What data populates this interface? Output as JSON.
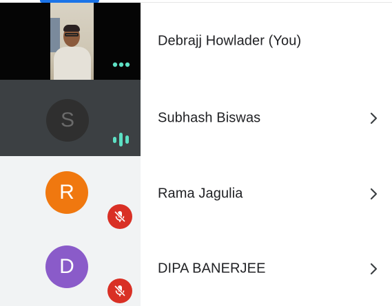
{
  "participants": [
    {
      "name": "Debrajj Howlader (You)",
      "tile": "video",
      "indicator": "more-dots"
    },
    {
      "name": "Subhash Biswas",
      "initial": "S",
      "tile": "avatar",
      "indicator": "speaking"
    },
    {
      "name": "Rama Jagulia",
      "initial": "R",
      "tile": "avatar",
      "indicator": "muted"
    },
    {
      "name": "DIPA BANERJEE",
      "initial": "D",
      "tile": "avatar",
      "indicator": "muted"
    }
  ],
  "colors": {
    "accent_teal": "#5de0c4",
    "mute_red": "#d93025",
    "avatar_r": "#f0780f",
    "avatar_d": "#8a5bc9",
    "tile_dark": "#3c4043",
    "tab_blue": "#1a73e8"
  },
  "icons": {
    "more": "more-dots-icon",
    "speaking": "audio-level-icon",
    "muted": "mic-off-icon",
    "chevron": "chevron-right-icon"
  }
}
